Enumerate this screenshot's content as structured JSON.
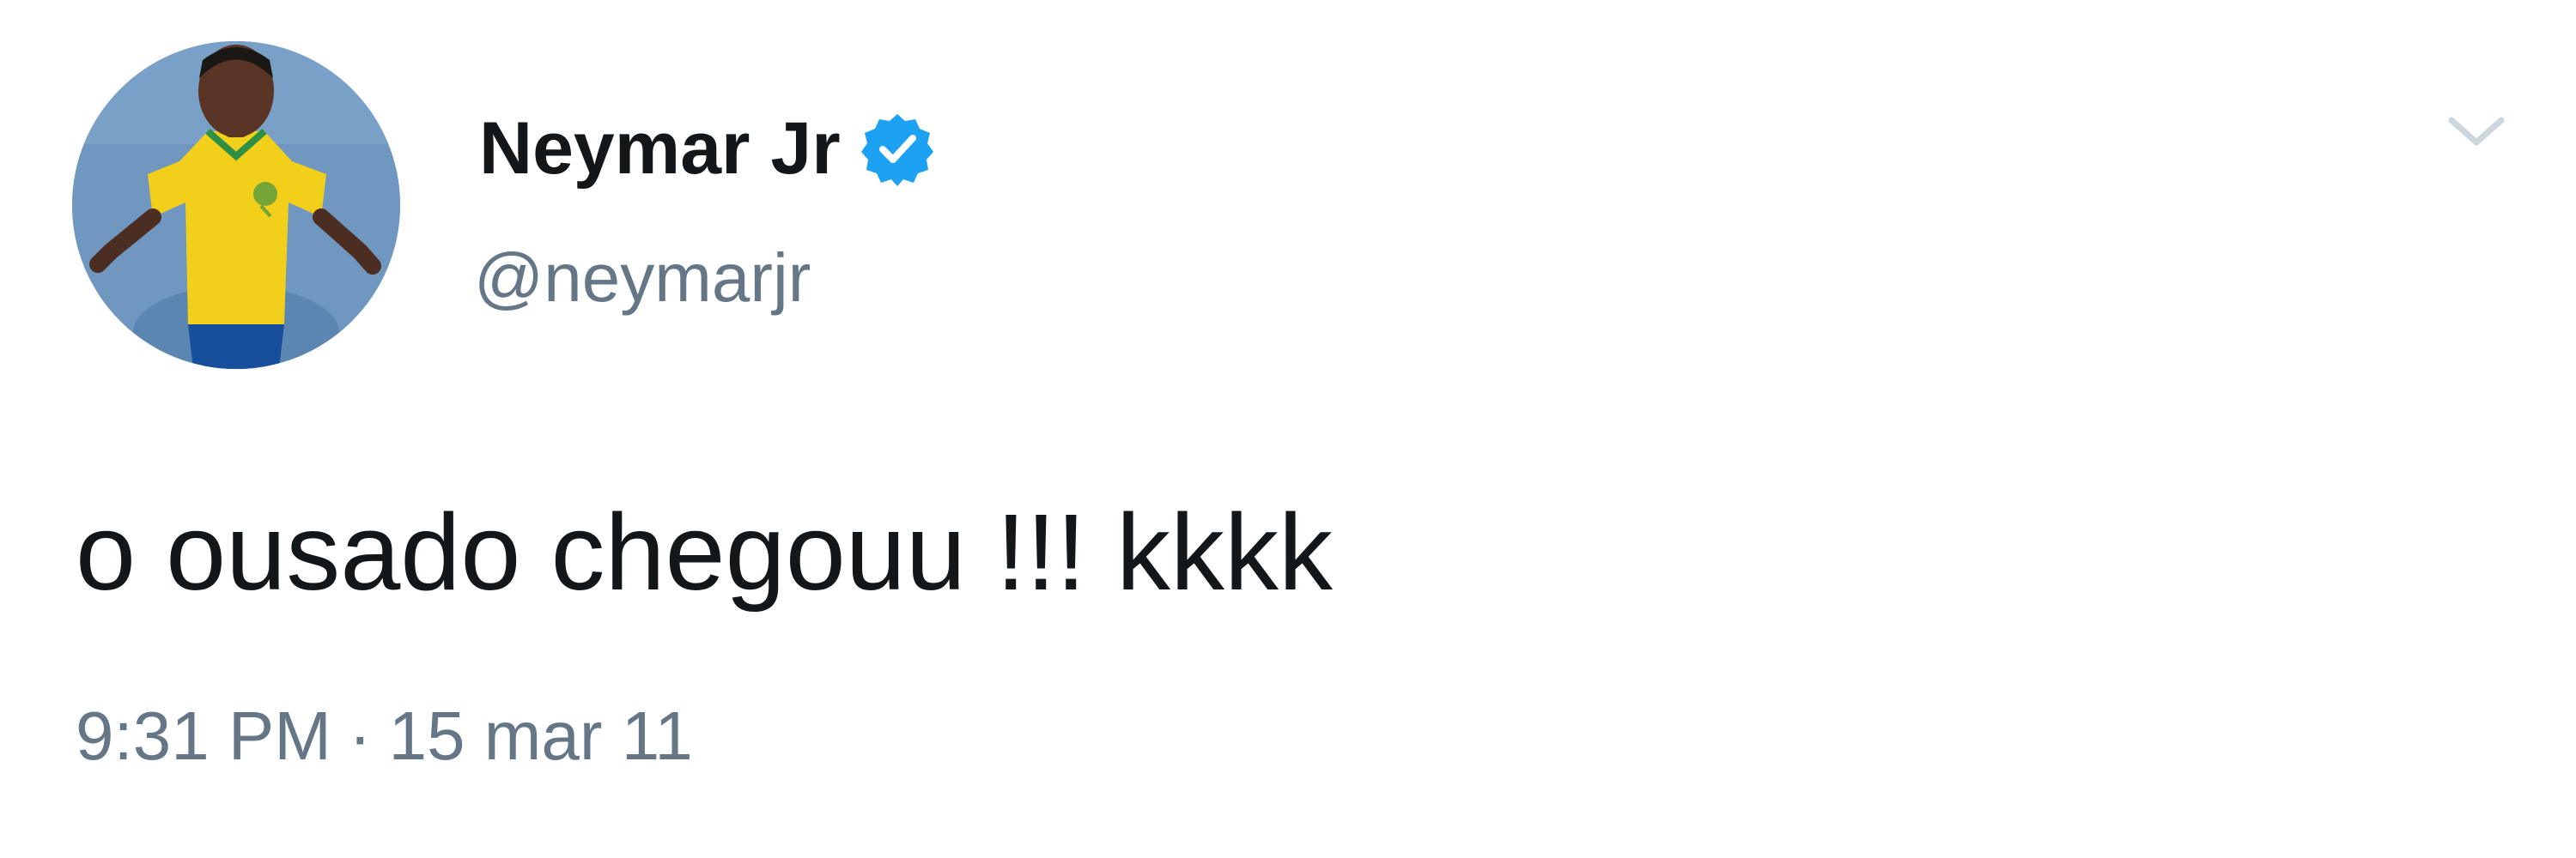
{
  "tweet": {
    "author": {
      "display_name": "Neymar Jr",
      "handle": "@neymarjr",
      "verified": true
    },
    "text": "o ousado chegouu !!! kkkk",
    "time": "9:31 PM",
    "separator": "·",
    "date": "15 mar 11"
  },
  "icons": {
    "verified": "verified-badge-icon",
    "menu": "chevron-down-icon"
  },
  "colors": {
    "text": "#14171a",
    "secondary": "#657786",
    "verified": "#1da1f2",
    "chevron": "#ccd6dd"
  }
}
